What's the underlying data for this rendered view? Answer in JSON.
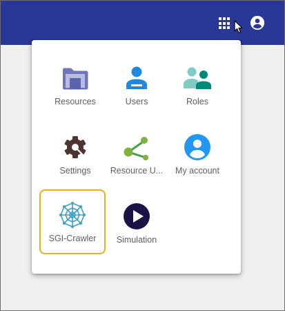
{
  "header": {
    "apps_icon": "apps-grid-icon",
    "account_icon": "account-circle-icon",
    "color": "#293796"
  },
  "apps_menu": {
    "items": [
      {
        "label": "Resources",
        "icon": "folder-icon"
      },
      {
        "label": "Users",
        "icon": "user-icon"
      },
      {
        "label": "Roles",
        "icon": "group-icon"
      },
      {
        "label": "Settings",
        "icon": "gear-icon"
      },
      {
        "label": "Resource U...",
        "icon": "share-icon"
      },
      {
        "label": "My account",
        "icon": "account-circle-icon"
      },
      {
        "label": "SGI-Crawler",
        "icon": "web-crawler-icon",
        "selected": true
      },
      {
        "label": "Simulation",
        "icon": "play-icon"
      }
    ],
    "highlight_color": "#f0ad1e"
  }
}
